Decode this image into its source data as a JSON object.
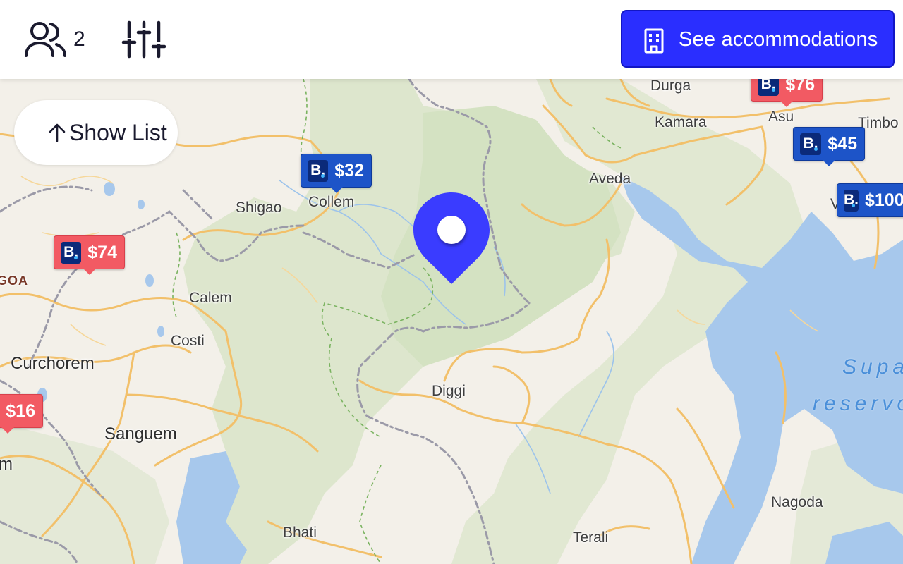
{
  "header": {
    "guests_icon": "users-icon",
    "guest_count": "2",
    "filters_icon": "sliders-icon",
    "cta_icon": "building-icon",
    "cta_label": "See accommodations",
    "cta_color": "#2a2eff"
  },
  "show_list": {
    "icon": "arrow-up-icon",
    "label": "Show List"
  },
  "map": {
    "places": [
      "Durga",
      "Asu",
      "Timbo",
      "Kamara",
      "Aveda",
      "Shigao",
      "Collem",
      "GOA",
      "Calem",
      "Costi",
      "Curchorem",
      "Diggi",
      "Sanguem",
      "m",
      "Bhati",
      "Terali",
      "Nagoda",
      "V"
    ],
    "water_labels": [
      "Supa",
      "reservo"
    ],
    "markers": [
      {
        "price": "$76",
        "color": "red"
      },
      {
        "price": "$45",
        "color": "blue"
      },
      {
        "price": "$100",
        "color": "blue"
      },
      {
        "price": "$32",
        "color": "blue"
      },
      {
        "price": "$74",
        "color": "red"
      },
      {
        "price": "$16",
        "color": "red"
      }
    ],
    "brand_badge": "B.",
    "pin_icon": "location-pin-icon",
    "pin_color": "#3a3cff",
    "marker_blue": "#1d54c8",
    "marker_red": "#f25a63"
  }
}
